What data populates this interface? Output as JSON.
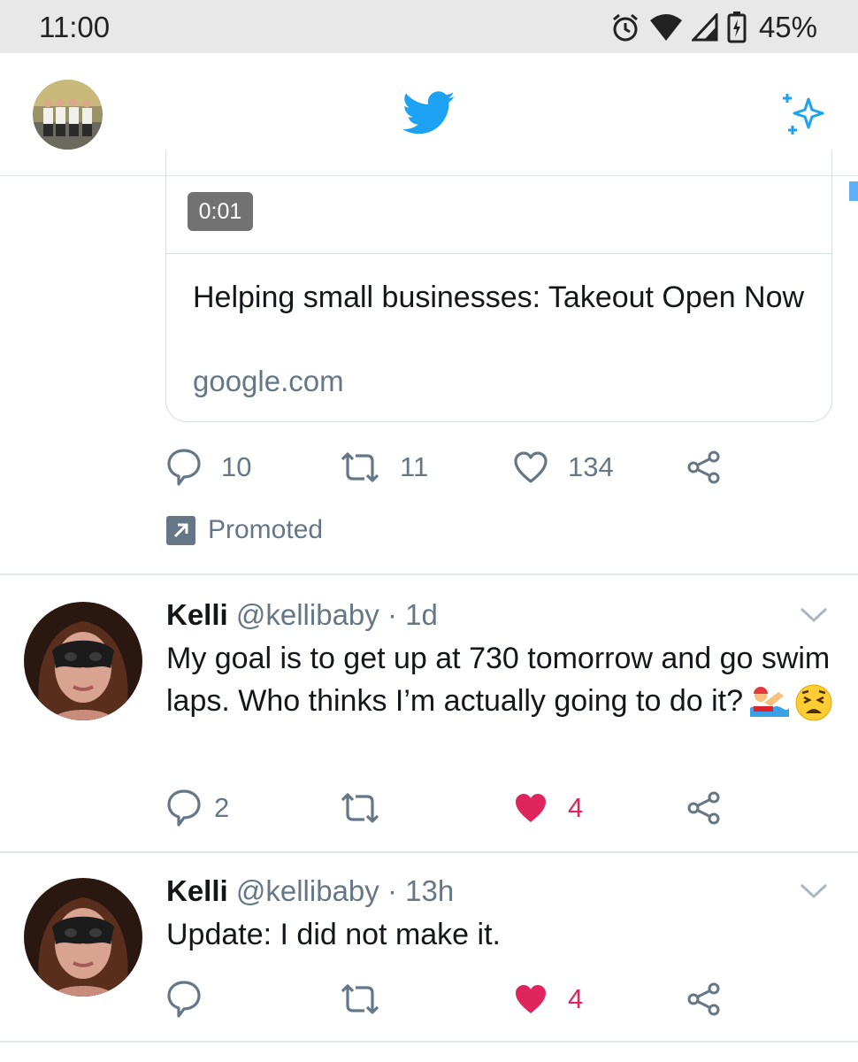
{
  "status": {
    "time": "11:00",
    "battery": "45%"
  },
  "header": {
    "logo": "twitter-bird-icon",
    "right_icon": "sparkle-icon"
  },
  "promoted_card": {
    "duration": "0:01",
    "title": "Helping small businesses: Takeout Open Now",
    "domain": "google.com",
    "replies": "10",
    "retweets": "11",
    "likes": "134",
    "promoted_label": "Promoted"
  },
  "tweets": [
    {
      "name": "Kelli",
      "handle": "@kellibaby",
      "separator": "·",
      "time": "1d",
      "text": "My goal is to get up at 730 tomorrow and go swim laps. Who thinks I’m actually going to do it?",
      "emojis": [
        "swimmer-emoji",
        "weary-face-emoji"
      ],
      "replies": "2",
      "retweets": "",
      "likes": "4",
      "liked": true
    },
    {
      "name": "Kelli",
      "handle": "@kellibaby",
      "separator": "·",
      "time": "13h",
      "text": "Update: I did not make it.",
      "replies": "",
      "retweets": "",
      "likes": "4",
      "liked": true
    }
  ],
  "colors": {
    "brand": "#1da1f2",
    "like": "#e0245e",
    "muted": "#657786"
  }
}
